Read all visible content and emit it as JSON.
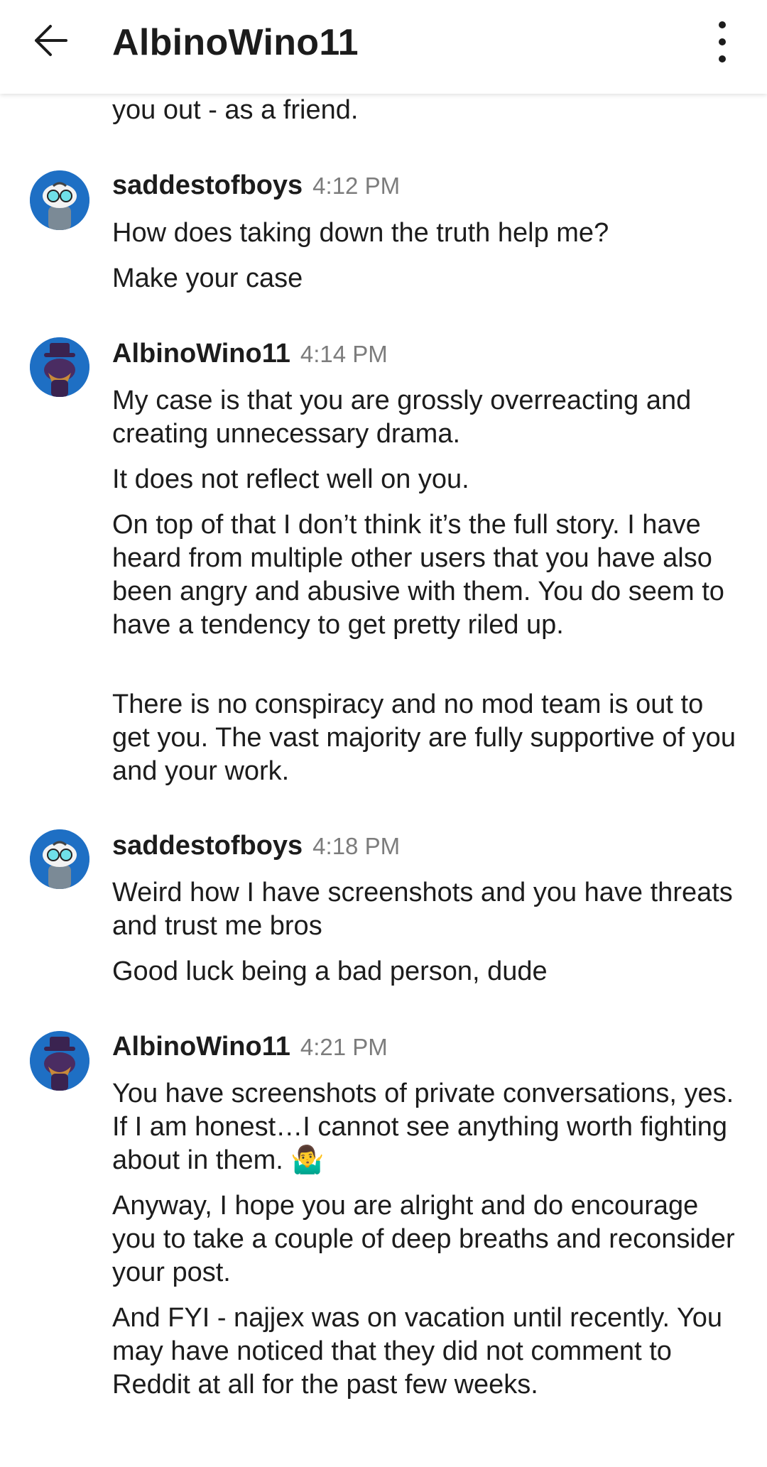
{
  "header": {
    "title": "AlbinoWino11",
    "back_icon": "arrow-left-icon",
    "more_icon": "more-vertical-icon"
  },
  "partial_message": {
    "text": "you out - as a friend."
  },
  "messages": [
    {
      "user": "saddestofboys",
      "time": "4:12 PM",
      "avatar": "snoo-glasses-avatar",
      "lines": [
        "How does taking down the truth help me?",
        "Make your case"
      ]
    },
    {
      "user": "AlbinoWino11",
      "time": "4:14 PM",
      "avatar": "snoo-tophat-avatar",
      "lines": [
        "My case is that you are grossly overreacting and creating unnecessary drama.",
        "It does not reflect well on you.",
        "On top of that I don’t think it’s the full story.  I have heard from multiple other users that you have also been angry and abusive with them.  You do seem to have a tendency to get pretty riled up.",
        "There is no conspiracy and no mod team is out to get you.  The vast majority are fully supportive of you and your work."
      ]
    },
    {
      "user": "saddestofboys",
      "time": "4:18 PM",
      "avatar": "snoo-glasses-avatar",
      "lines": [
        "Weird how I have screenshots and you have threats and trust me bros",
        "Good luck being a bad person, dude"
      ]
    },
    {
      "user": "AlbinoWino11",
      "time": "4:21 PM",
      "avatar": "snoo-tophat-avatar",
      "lines": [
        "You have screenshots of private conversations, yes.  If I am honest…I cannot see anything worth fighting about in them.  🤷‍♂️",
        "Anyway, I hope you are alright and do encourage you to take a couple of deep breaths and reconsider your post.",
        "And FYI - najjex was on vacation until recently.  You may have noticed that they did not comment to Reddit at all for the past few weeks."
      ]
    }
  ],
  "colors": {
    "avatar_bg": "#1e6fc4",
    "timestamp": "#7c7c7c",
    "text": "#1c1c1c"
  }
}
